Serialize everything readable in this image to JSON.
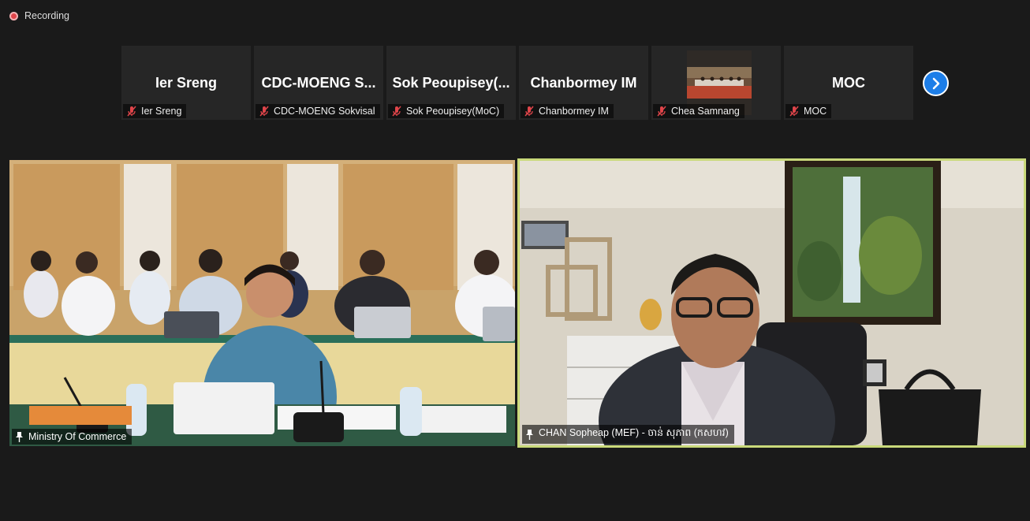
{
  "recording": {
    "label": "Recording"
  },
  "participants": [
    {
      "display_name": "Ier Sreng",
      "label": "Ier Sreng"
    },
    {
      "display_name": "CDC-MOENG  S...",
      "label": "CDC-MOENG Sokvisal"
    },
    {
      "display_name": "Sok  Peoupisey(...",
      "label": "Sok Peoupisey(MoC)"
    },
    {
      "display_name": "Chanbormey IM",
      "label": "Chanbormey IM"
    },
    {
      "display_name": "",
      "label": "Chea Samnang"
    },
    {
      "display_name": "MOC",
      "label": "MOC"
    }
  ],
  "icons": {
    "mic": "mic-muted-icon",
    "pin": "pin-icon",
    "next": "chevron-right-icon",
    "rec": "record-icon"
  },
  "colors": {
    "active_speaker_border": "#c9d97a",
    "next_button": "#1d7ee8",
    "muted": "#e0454a"
  },
  "videos": {
    "left": {
      "label": "Ministry Of Commerce"
    },
    "right": {
      "label": "CHAN Sopheap (MEF) - ចាន់ សុភាព (កសហវ)"
    }
  }
}
